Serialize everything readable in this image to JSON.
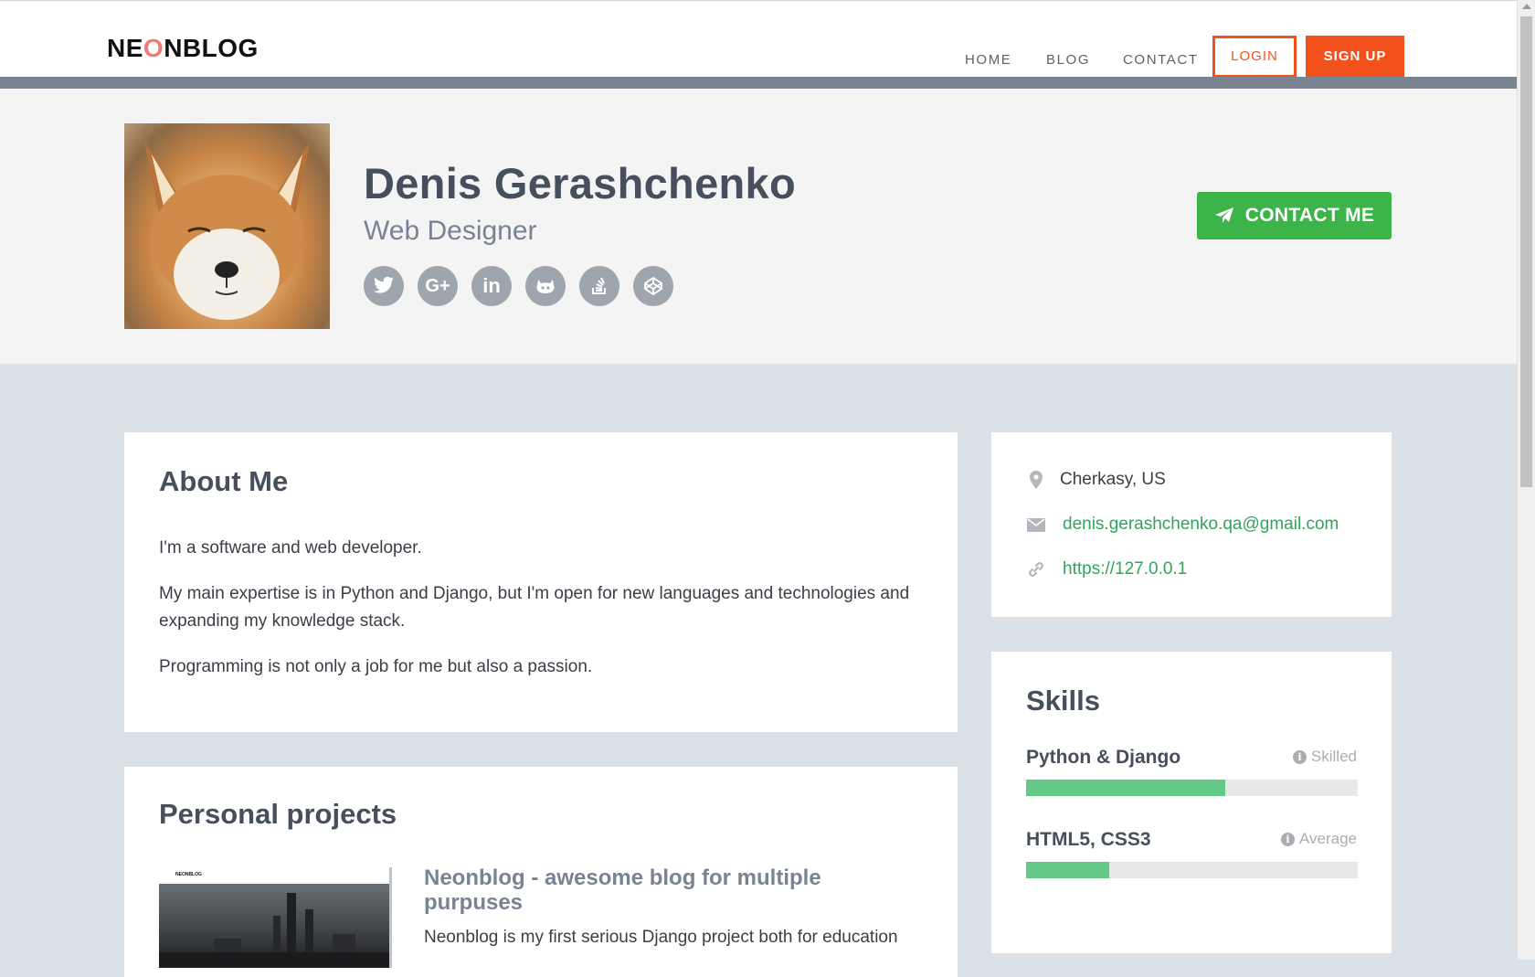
{
  "navbar": {
    "logo_pre": "NE",
    "logo_o": "O",
    "logo_post": "NBLOG",
    "links": [
      {
        "label": "HOME"
      },
      {
        "label": "BLOG"
      },
      {
        "label": "CONTACT"
      }
    ],
    "login_label": "LOGIN",
    "signup_label": "SIGN UP",
    "accent_color": "#f2511b"
  },
  "profile": {
    "name": "Denis Gerashchenko",
    "job_title": "Web Designer",
    "avatar_icon": "fox-avatar-image",
    "socials": [
      {
        "icon": "twitter-icon",
        "glyph": "🐦"
      },
      {
        "icon": "google-plus-icon",
        "glyph": "G+"
      },
      {
        "icon": "linkedin-icon",
        "glyph": "in"
      },
      {
        "icon": "github-icon",
        "glyph": "◉"
      },
      {
        "icon": "stackoverflow-icon",
        "glyph": "≣"
      },
      {
        "icon": "codepen-icon",
        "glyph": "⬡"
      }
    ],
    "contact_button_label": "CONTACT ME",
    "contact_button_color": "#3cb44a"
  },
  "about": {
    "title": "About Me",
    "paragraphs": [
      "I'm a software and web developer.",
      "My main expertise is in Python and Django, but I'm open for new languages and technologies and expanding my knowledge stack.",
      "Programming is not only a job for me but also a passion."
    ]
  },
  "projects": {
    "title": "Personal projects",
    "items": [
      {
        "thumb_logo": "NEONBLOG",
        "title": "Neonblog - awesome blog for multiple purpuses",
        "description": "Neonblog is my first serious Django project both for education"
      }
    ]
  },
  "contact_info": {
    "location": "Cherkasy, US",
    "email": "denis.gerashchenko.qa@gmail.com",
    "website": "https://127.0.0.1",
    "link_color": "#2ea65a"
  },
  "skills": {
    "title": "Skills",
    "items": [
      {
        "name": "Python & Django",
        "level": "Skilled",
        "fill": 0.6
      },
      {
        "name": "HTML5, CSS3",
        "level": "Average",
        "fill": 0.25
      }
    ],
    "bar_color": "#64c887"
  }
}
